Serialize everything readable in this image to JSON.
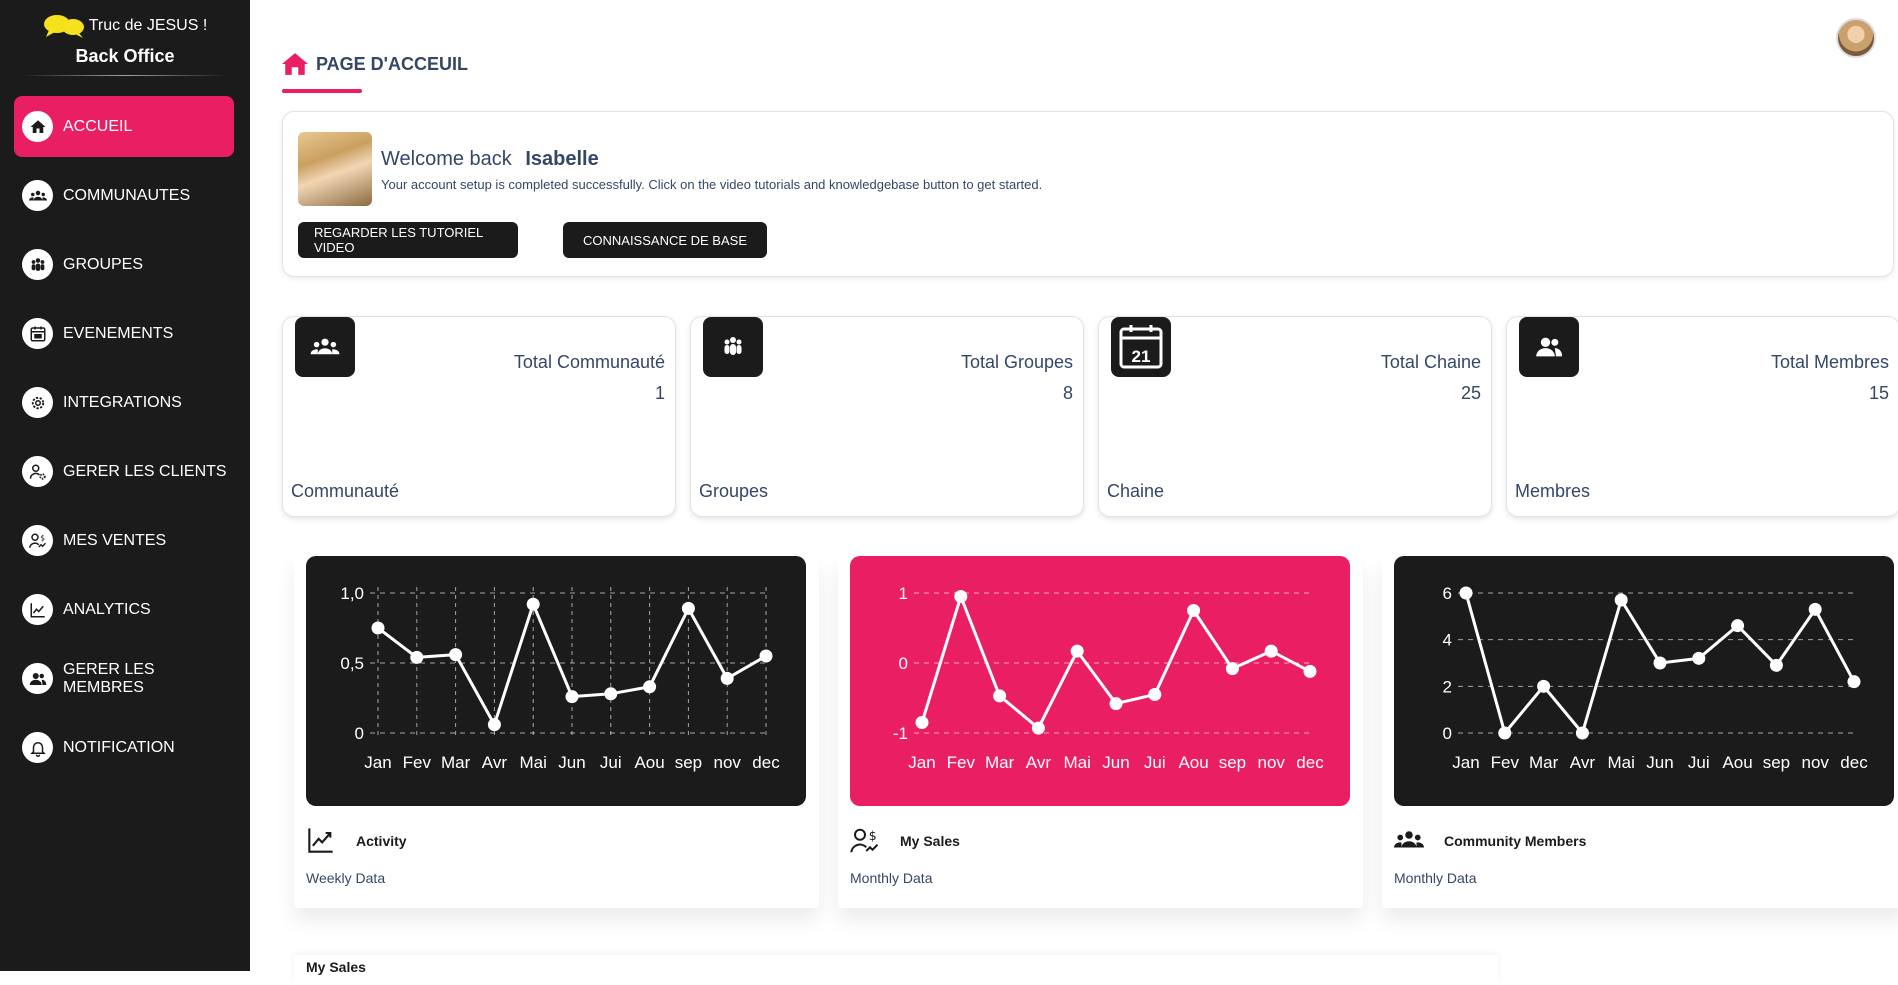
{
  "brand": {
    "name": "Truc de JESUS !",
    "title": "Back Office"
  },
  "nav": [
    {
      "label": "ACCUEIL",
      "icon": "home-icon",
      "active": true
    },
    {
      "label": "COMMUNAUTES",
      "icon": "community-icon"
    },
    {
      "label": "GROUPES",
      "icon": "groups-icon"
    },
    {
      "label": "EVENEMENTS",
      "icon": "calendar-icon"
    },
    {
      "label": "INTEGRATIONS",
      "icon": "gear-icon"
    },
    {
      "label": "GERER LES CLIENTS",
      "icon": "user-settings-icon"
    },
    {
      "label": "MES VENTES",
      "icon": "sales-icon"
    },
    {
      "label": "ANALYTICS",
      "icon": "analytics-icon"
    },
    {
      "label": "GERER LES MEMBRES",
      "icon": "members-icon"
    },
    {
      "label": "NOTIFICATION",
      "icon": "bell-icon"
    }
  ],
  "page": {
    "title": "PAGE D'ACCEUIL"
  },
  "welcome": {
    "greeting": "Welcome back",
    "user": "Isabelle",
    "message": "Your account setup is completed successfully. Click on the video tutorials and knowledgebase button to get started.",
    "btn_tutorial": "REGARDER LES TUTORIEL VIDEO",
    "btn_knowledge": "CONNAISSANCE DE BASE"
  },
  "stats": [
    {
      "label": "Total Communauté",
      "value": "1",
      "footer": "Communauté",
      "icon": "community-icon"
    },
    {
      "label": "Total Groupes",
      "value": "8",
      "footer": "Groupes",
      "icon": "groups-icon"
    },
    {
      "label": "Total Chaine",
      "value": "25",
      "footer": "Chaine",
      "icon": "calendar-icon",
      "icon_text": "21"
    },
    {
      "label": "Total Membres",
      "value": "15",
      "footer": "Membres",
      "icon": "members-icon"
    }
  ],
  "colors": {
    "accent": "#e91e63",
    "dark": "#1b1b1b",
    "text": "#344767"
  },
  "chart_data": [
    {
      "type": "line",
      "title": "Activity",
      "subtitle": "Weekly Data",
      "background": "#1b1b1b",
      "categories": [
        "Jan",
        "Fev",
        "Mar",
        "Avr",
        "Mai",
        "Jun",
        "Jui",
        "Aou",
        "sep",
        "nov",
        "dec"
      ],
      "values": [
        0.75,
        0.54,
        0.56,
        0.06,
        0.92,
        0.26,
        0.28,
        0.33,
        0.89,
        0.39,
        0.55
      ],
      "ylim": [
        0,
        1
      ],
      "yticks": [
        "0",
        "0,5",
        "1,0"
      ],
      "grid": "vertical and horizontal dashed"
    },
    {
      "type": "line",
      "title": "My Sales",
      "subtitle": "Monthly Data",
      "background": "#e91e63",
      "categories": [
        "Jan",
        "Fev",
        "Mar",
        "Avr",
        "Mai",
        "Jun",
        "Jui",
        "Aou",
        "sep",
        "nov",
        "dec"
      ],
      "values": [
        -0.85,
        0.95,
        -0.47,
        -0.93,
        0.17,
        -0.58,
        -0.45,
        0.75,
        -0.08,
        0.17,
        -0.12
      ],
      "ylim": [
        -1,
        1
      ],
      "yticks": [
        "-1",
        "0",
        "1"
      ],
      "grid": "horizontal dashed"
    },
    {
      "type": "line",
      "title": "Community Members",
      "subtitle": "Monthly Data",
      "background": "#1b1b1b",
      "categories": [
        "Jan",
        "Fev",
        "Mar",
        "Avr",
        "Mai",
        "Jun",
        "Jui",
        "Aou",
        "sep",
        "nov",
        "dec"
      ],
      "values": [
        6,
        0,
        2,
        0,
        5.7,
        3,
        3.2,
        4.6,
        2.9,
        5.3,
        2.2
      ],
      "ylim": [
        0,
        6
      ],
      "yticks": [
        "0",
        "2",
        "4",
        "6"
      ],
      "grid": "horizontal dashed"
    }
  ],
  "bottom": {
    "title": "My Sales"
  }
}
